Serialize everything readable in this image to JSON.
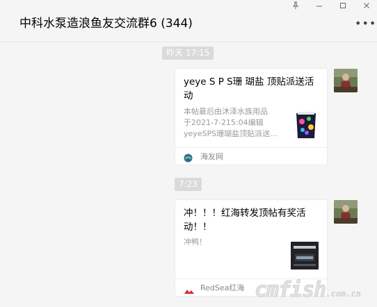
{
  "window": {
    "title": "中科水泵造浪鱼友交流群6 (344)",
    "more_label": "•••"
  },
  "messages": [
    {
      "timestamp": "昨天 17:15",
      "card": {
        "title": "yeye S P S珊 瑚盐 顶贴派送活动",
        "desc_lines": [
          "本帖最后由沐泽水族用品",
          "于2021-7-215:04编辑",
          "yeyeSPS珊瑚盐顶贴派送..."
        ],
        "source": "海友网"
      }
    },
    {
      "timestamp": "7:23",
      "card": {
        "title": "冲！！！红海转发顶帖有奖活动！！",
        "desc_lines": [
          "冲鸭！"
        ],
        "source": "RedSea红海"
      }
    }
  ],
  "watermark": {
    "text": "cmfish",
    "suffix": ".com.cn"
  },
  "colors": {
    "background": "#f5f5f5",
    "timestamp_bg": "#dadada",
    "card_bg": "#ffffff",
    "desc_text": "#9a9a9a"
  },
  "icons": [
    "pin-icon",
    "minimize-icon",
    "maximize-icon",
    "close-icon",
    "more-icon",
    "haiyou-logo-icon",
    "redsea-logo-icon"
  ]
}
